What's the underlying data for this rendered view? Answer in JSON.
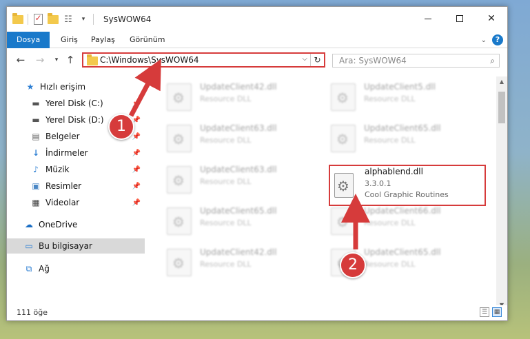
{
  "window": {
    "title": "SysWOW64"
  },
  "ribbon": {
    "tabs": [
      "Dosya",
      "Giriş",
      "Paylaş",
      "Görünüm"
    ],
    "help_label": "?"
  },
  "address": {
    "path": "C:\\Windows\\SysWOW64"
  },
  "search": {
    "placeholder": "Ara: SysWOW64"
  },
  "navpane": {
    "items": [
      {
        "label": "Hızlı erişim",
        "icon": "star-icon",
        "pinned": false
      },
      {
        "label": "Yerel Disk (C:)",
        "icon": "drive-icon",
        "pinned": true
      },
      {
        "label": "Yerel Disk (D:)",
        "icon": "drive-icon",
        "pinned": true
      },
      {
        "label": "Belgeler",
        "icon": "documents-icon",
        "pinned": true
      },
      {
        "label": "İndirmeler",
        "icon": "download-icon",
        "pinned": true
      },
      {
        "label": "Müzik",
        "icon": "music-icon",
        "pinned": true
      },
      {
        "label": "Resimler",
        "icon": "pictures-icon",
        "pinned": true
      },
      {
        "label": "Videolar",
        "icon": "videos-icon",
        "pinned": true
      },
      {
        "label": "OneDrive",
        "icon": "cloud-icon",
        "pinned": false
      },
      {
        "label": "Bu bilgisayar",
        "icon": "computer-icon",
        "pinned": false,
        "selected": true
      },
      {
        "label": "Ağ",
        "icon": "network-icon",
        "pinned": false
      }
    ]
  },
  "files": [
    {
      "name": "UpdateClient42.dll",
      "desc": "Resource DLL"
    },
    {
      "name": "UpdateClient5.dll",
      "desc": "Resource DLL"
    },
    {
      "name": "UpdateClient63.dll",
      "desc": "Resource DLL"
    },
    {
      "name": "UpdateClient65.dll",
      "desc": "Resource DLL"
    },
    {
      "name": "UpdateClient63.dll",
      "desc": "Resource DLL"
    },
    {
      "name": "UpdateClient65.dll",
      "desc": "Resource DLL"
    },
    {
      "name": "UpdateClient66.dll",
      "desc": "Resource DLL"
    },
    {
      "name": "UpdateClient42.dll",
      "desc": "Resource DLL"
    },
    {
      "name": "UpdateClient65.dll",
      "desc": "Resource DLL"
    }
  ],
  "highlight_file": {
    "name": "alphablend.dll",
    "version": "3.3.0.1",
    "desc": "Cool Graphic Routines"
  },
  "status": {
    "count": "111 öğe"
  },
  "annotations": {
    "step1": "1",
    "step2": "2",
    "accent": "#d63b3b"
  }
}
